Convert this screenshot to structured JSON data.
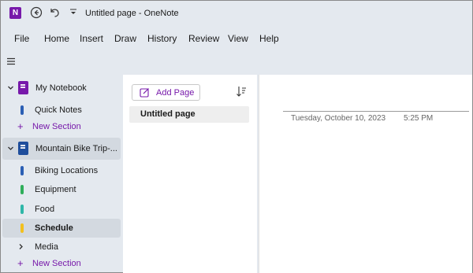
{
  "titlebar": {
    "app_logo_letter": "N",
    "title": "Untitled page  -  OneNote",
    "icons": [
      "back-icon",
      "undo-icon",
      "quick-access-dropdown-icon"
    ]
  },
  "menu": [
    "File",
    "Home",
    "Insert",
    "Draw",
    "History",
    "Review",
    "View",
    "Help"
  ],
  "notebooks": [
    {
      "name": "My Notebook",
      "color": "#7719aa",
      "sections": [
        {
          "name": "Quick Notes",
          "color": "#2b5fb4"
        }
      ],
      "new_section_label": "New Section"
    },
    {
      "name": "Mountain Bike Trip-...",
      "color": "#1f4e9c",
      "sections": [
        {
          "name": "Biking Locations",
          "color": "#2b5fb4"
        },
        {
          "name": "Equipment",
          "color": "#2fae5b"
        },
        {
          "name": "Food",
          "color": "#2eb7a8"
        },
        {
          "name": "Schedule",
          "color": "#f2c01e",
          "selected": true
        },
        {
          "name": "Media",
          "color": "#666666",
          "group": true
        }
      ],
      "new_section_label": "New Section"
    }
  ],
  "page_list": {
    "add_page_label": "Add Page",
    "pages": [
      "Untitled page"
    ]
  },
  "canvas": {
    "date": "Tuesday, October 10, 2023",
    "time": "5:25 PM"
  },
  "colors": {
    "accent": "#7719aa",
    "background": "#e4e9ef",
    "selected_row": "#d3d9e0"
  }
}
